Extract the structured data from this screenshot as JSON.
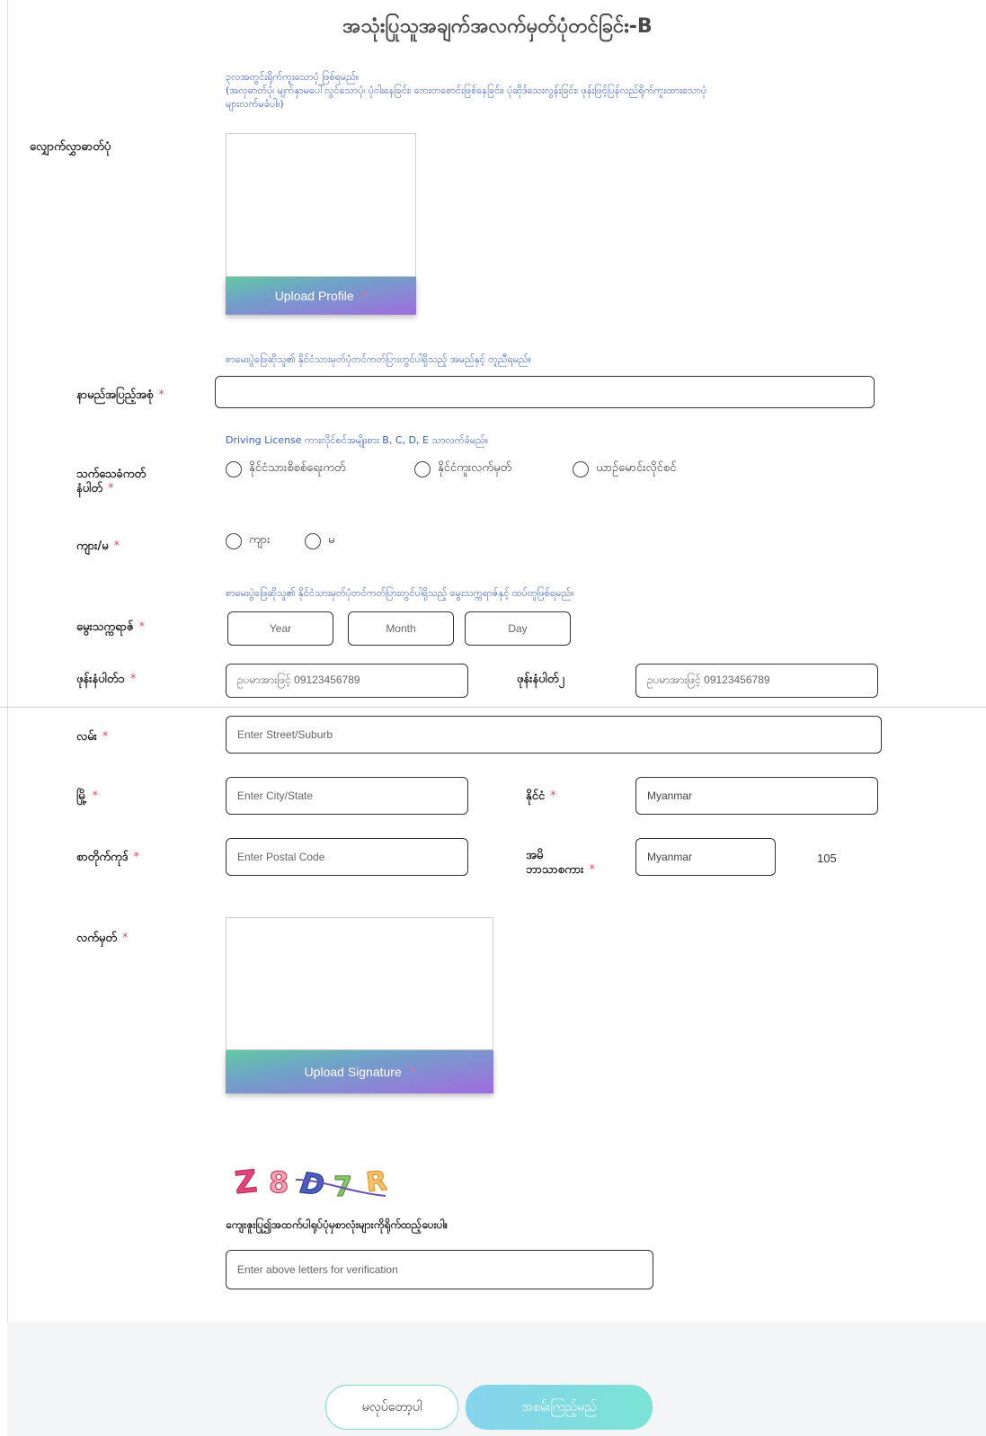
{
  "title": "အသုံးပြုသူအချက်အလက်မှတ်ပုံတင်ခြင်း-B",
  "profile": {
    "label": "လျှောက်လွှာဓာတ်ပုံ",
    "note_line1": "၃လအတွင်းရိုက်ကူးသောပုံ ဖြစ်ရမည်။",
    "note_line2": "(အလှဓာတ်ပုံ၊ မျက်နှာမပေါ်လွင်သောပုံ၊ ပုံဝါးနေခြင်း၊ ဘေးတစောင်းဖြစ်နေခြင်း၊ ပုံဆိုဒ်သေးလွန်းခြင်း၊ ဖုန်းဖြင့်ပြန်လည်ရိုက်ကူးထားသောပုံ",
    "note_line3": "များလက်မခံပါ။)",
    "upload_label": "Upload Profile",
    "required_mark": "*"
  },
  "fullname": {
    "note": "စာမေးပွဲဖြေဆိုသူ၏ နိုင်ငံသားမှတ်ပုံတင်ကတ်ပြားတွင်ပါရှိသည့် အမည်နှင့် တူညီရမည်။",
    "label": "နာမည်အပြည့်အစုံ",
    "required_mark": "*",
    "value": ""
  },
  "id_card": {
    "note": "Driving License ကားလိုင်စင်အမျိုးစား B, C, D, E သာလက်ခံမည်။",
    "label_line1": "သက်သေခံကတ်",
    "label_line2": "နံပါတ်",
    "required_mark": "*",
    "options": [
      "နိုင်ငံသားစိစစ်ရေးကတ်",
      "နိုင်ငံကူးလက်မှတ်",
      "ယာဉ်မောင်းလိုင်စင်"
    ]
  },
  "gender": {
    "label": "ကျား/မ",
    "required_mark": "*",
    "options": [
      "ကျား",
      "မ"
    ]
  },
  "dob": {
    "note": "စာမေးပွဲဖြေဆိုသူ၏ နိုင်ငံသားမှတ်ပုံတင်ကတ်ပြားတွင်ပါရှိသည့် မွေးသက္ကရာဇ်နှင့် ထပ်တူဖြစ်ရမည်။",
    "label": "မွေးသက္ကရာဇ်",
    "required_mark": "*",
    "year": "Year",
    "month": "Month",
    "day": "Day"
  },
  "phone": {
    "label1": "ဖုန်းနံပါတ်၁",
    "required_mark": "*",
    "placeholder1": "ဥပမာအားဖြင့် 09123456789",
    "label2": "ဖုန်းနံပါတ်၂",
    "placeholder2": "ဥပမာအားဖြင့် 09123456789"
  },
  "street": {
    "label": "လမ်း",
    "required_mark": "*",
    "placeholder": "Enter Street/Suburb"
  },
  "city": {
    "label": "မြို့",
    "required_mark": "*",
    "placeholder": "Enter City/State"
  },
  "country": {
    "label": "နိုင်ငံ",
    "required_mark": "*",
    "value": "Myanmar"
  },
  "postal": {
    "label": "စာတိုက်ကုဒ်",
    "required_mark": "*",
    "placeholder": "Enter Postal Code"
  },
  "language": {
    "label_line1": "အမိ",
    "label_line2": "ဘာသာစကား",
    "required_mark": "*",
    "value": "Myanmar",
    "count": "105"
  },
  "signature": {
    "label": "လက်မှတ်",
    "required_mark": "*",
    "upload_label": "Upload Signature",
    "upload_mark": "*"
  },
  "captcha": {
    "chars": [
      "Z",
      "8",
      "D",
      "7",
      "R"
    ],
    "instruction": "ကျေးဇူးပြု၍အထက်ပါရုပ်ပုံမှစာလုံးများကိုရိုက်ထည့်ပေးပါ။",
    "placeholder": "Enter above letters for verification"
  },
  "buttons": {
    "cancel": "မလုပ်တော့ပါ",
    "submit": "အစမ်းကြည့်မည်"
  },
  "colors": {
    "required": "#e34b5f",
    "note_blue": "#3a5fb7",
    "submit_gradient_start": "#86d3ee",
    "submit_gradient_end": "#7be3d5"
  }
}
